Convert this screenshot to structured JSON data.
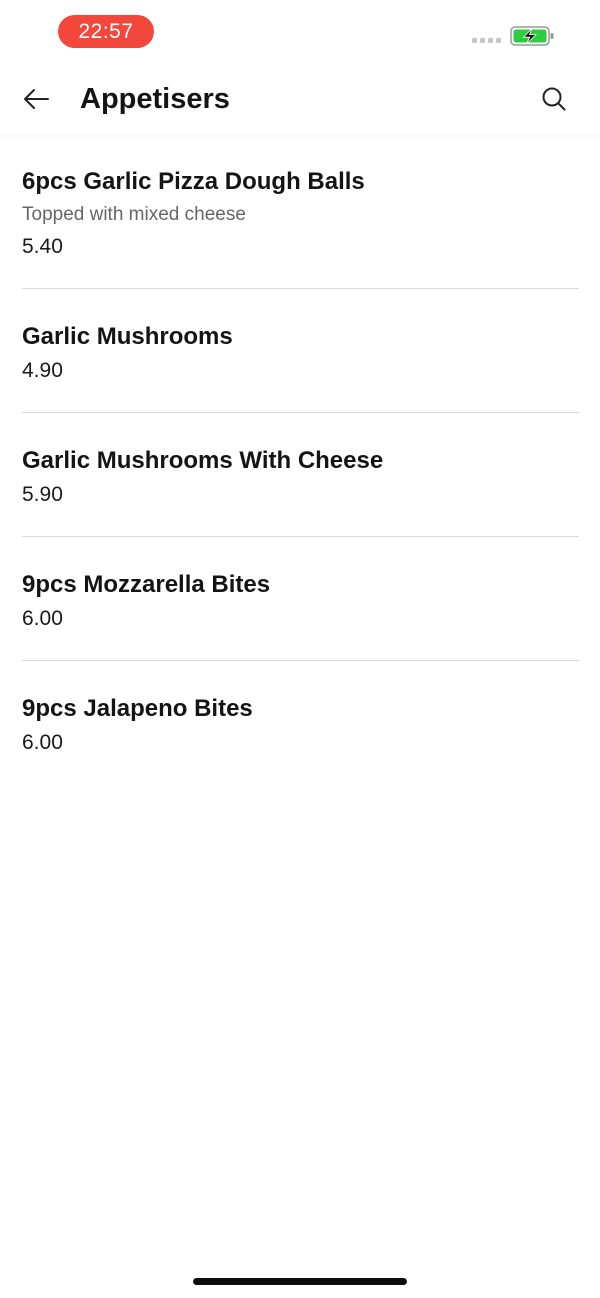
{
  "status_bar": {
    "time": "22:57",
    "time_pill_color": "#f2473b",
    "battery_color": "#2ecc40",
    "battery_state": "charging"
  },
  "header": {
    "title": "Appetisers",
    "back_icon": "arrow-left-icon",
    "search_icon": "search-icon"
  },
  "menu": {
    "items": [
      {
        "name": "6pcs Garlic Pizza Dough Balls",
        "description": "Topped with mixed cheese",
        "price": "5.40"
      },
      {
        "name": "Garlic Mushrooms",
        "description": "",
        "price": "4.90"
      },
      {
        "name": "Garlic Mushrooms With Cheese",
        "description": "",
        "price": "5.90"
      },
      {
        "name": "9pcs Mozzarella Bites",
        "description": "",
        "price": "6.00"
      },
      {
        "name": "9pcs Jalapeno Bites",
        "description": "",
        "price": "6.00"
      }
    ]
  }
}
